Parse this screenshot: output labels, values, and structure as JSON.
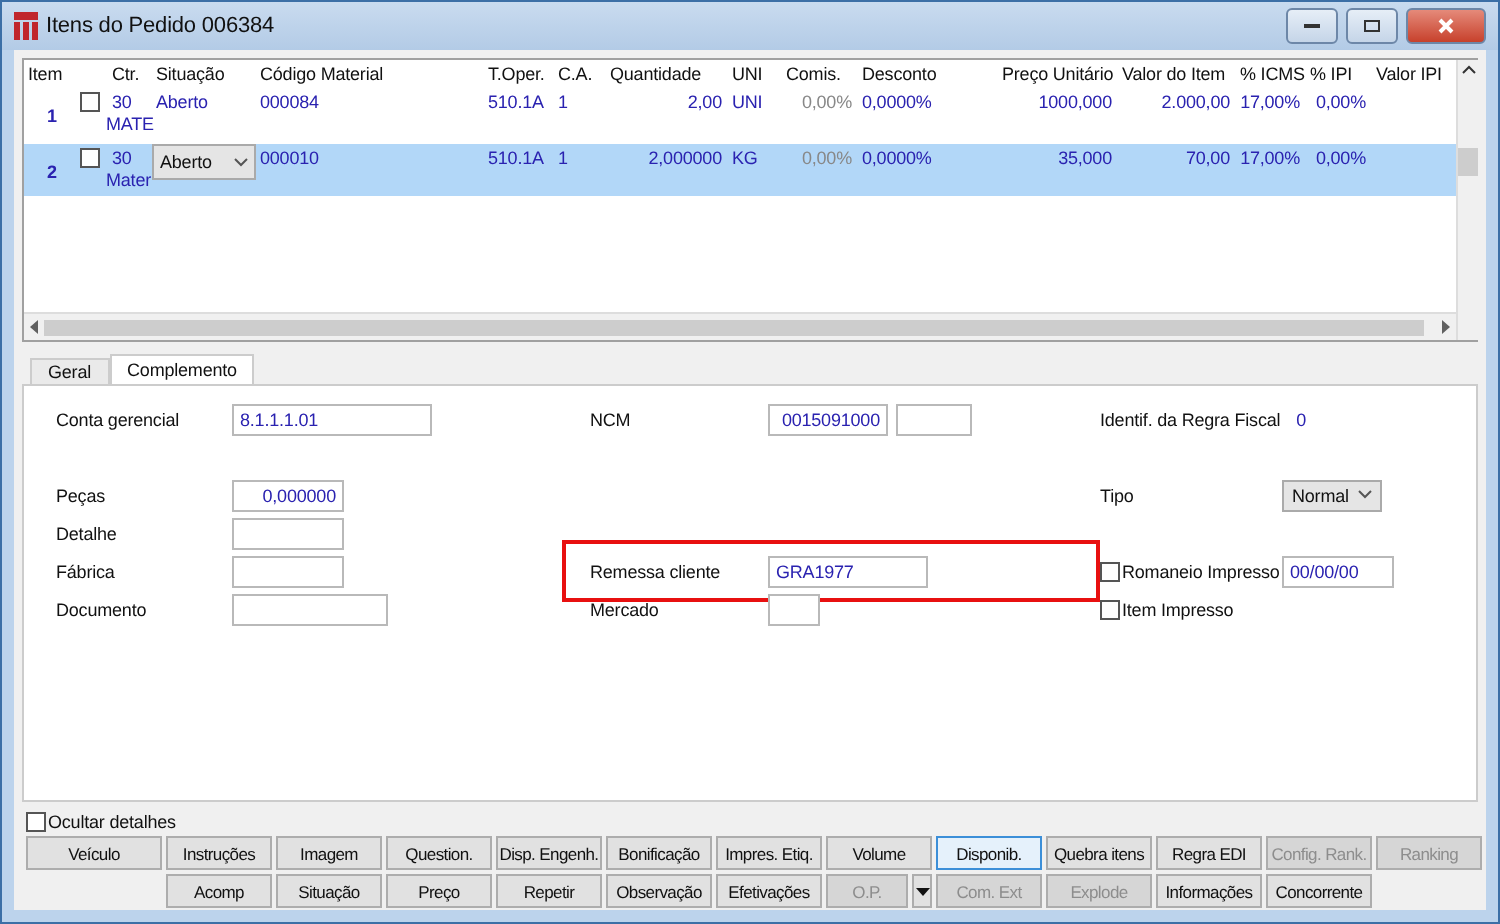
{
  "window": {
    "title": "Itens do Pedido 006384"
  },
  "table": {
    "columns": [
      "Item",
      "",
      "Ctr.",
      "Situação",
      "Código Material",
      "T.Oper.",
      "C.A.",
      "Quantidade",
      "UNI",
      "Comis.",
      "Desconto",
      "Preço Unitário",
      "Valor do Item",
      "% ICMS",
      "% IPI",
      "Valor IPI"
    ],
    "rows": [
      {
        "selected": false,
        "checked": false,
        "item": "1",
        "ctr": "30",
        "ctr_desc": "MATE",
        "situacao": "Aberto",
        "kind": "text",
        "codigo": "000084",
        "toper": "510.1A",
        "ca": "1",
        "quantidade": "2,00",
        "uni": "UNI",
        "comis": "0,00%",
        "desconto": "0,0000%",
        "preco": "1000,000",
        "valor": "2.000,00",
        "icms": "17,00%",
        "ipi": "0,00%"
      },
      {
        "selected": true,
        "checked": false,
        "item": "2",
        "ctr": "30",
        "ctr_desc": "Mater",
        "situacao": "Aberto",
        "kind": "dropdown",
        "codigo": "000010",
        "toper": "510.1A",
        "ca": "1",
        "quantidade": "2,000000",
        "uni": "KG",
        "comis": "0,00%",
        "desconto": "0,0000%",
        "preco": "35,000",
        "valor": "70,00",
        "icms": "17,00%",
        "ipi": "0,00%"
      }
    ]
  },
  "tabs": [
    {
      "label": "Geral",
      "selected": false
    },
    {
      "label": "Complemento",
      "selected": true
    }
  ],
  "form": {
    "conta_gerencial": {
      "label": "Conta gerencial",
      "value": "8.1.1.1.01"
    },
    "ncm": {
      "label": "NCM",
      "value": "0015091000"
    },
    "regra_fiscal": {
      "label": "Identif. da Regra Fiscal",
      "value": "0"
    },
    "pecas": {
      "label": "Peças",
      "value": "0,000000"
    },
    "tipo": {
      "label": "Tipo",
      "value": "Normal"
    },
    "detalhe": {
      "label": "Detalhe"
    },
    "fabrica": {
      "label": "Fábrica"
    },
    "remessa": {
      "label": "Remessa cliente",
      "value": "GRA1977",
      "highlighted": true
    },
    "romaneio": {
      "label": "Romaneio Impresso",
      "checked": false,
      "value": "00/00/00"
    },
    "documento": {
      "label": "Documento"
    },
    "mercado": {
      "label": "Mercado"
    },
    "item_impresso": {
      "label": "Item Impresso",
      "checked": false
    }
  },
  "ocultar_detalhes": {
    "label": "Ocultar detalhes",
    "checked": false
  },
  "buttons": [
    [
      {
        "label": "Veículo",
        "disabled": false,
        "focused": false
      },
      {
        "label": "Instruções",
        "disabled": false,
        "focused": false
      },
      {
        "label": "Imagem",
        "disabled": false,
        "focused": false
      },
      {
        "label": "Question.",
        "disabled": false,
        "focused": false
      },
      {
        "label": "Disp. Engenh.",
        "disabled": false,
        "focused": false
      },
      {
        "label": "Bonificação",
        "disabled": false,
        "focused": false
      },
      {
        "label": "Impres. Etiq.",
        "disabled": false,
        "focused": false
      },
      {
        "label": "Volume",
        "disabled": false,
        "focused": false
      },
      {
        "label": "Disponib.",
        "disabled": false,
        "focused": true
      },
      {
        "label": "Quebra itens",
        "disabled": false,
        "focused": false
      },
      {
        "label": "Regra EDI",
        "disabled": false,
        "focused": false
      },
      {
        "label": "Config. Rank.",
        "disabled": true,
        "focused": false
      },
      {
        "label": "Ranking",
        "disabled": true,
        "focused": false
      }
    ],
    [
      {
        "label": "Acomp",
        "disabled": false,
        "focused": false
      },
      {
        "label": "Situação",
        "disabled": false,
        "focused": false
      },
      {
        "label": "Preço",
        "disabled": false,
        "focused": false
      },
      {
        "label": "Repetir",
        "disabled": false,
        "focused": false
      },
      {
        "label": "Observação",
        "disabled": false,
        "focused": false
      },
      {
        "label": "Efetivações",
        "disabled": false,
        "focused": false
      },
      {
        "label": "O.P.",
        "disabled": true,
        "focused": false,
        "kind": "split"
      },
      {
        "label": "Com. Ext",
        "disabled": true,
        "focused": false
      },
      {
        "label": "Explode",
        "disabled": true,
        "focused": false
      },
      {
        "label": "Informações",
        "disabled": false,
        "focused": false
      },
      {
        "label": "Concorrente",
        "disabled": false,
        "focused": false
      }
    ]
  ]
}
